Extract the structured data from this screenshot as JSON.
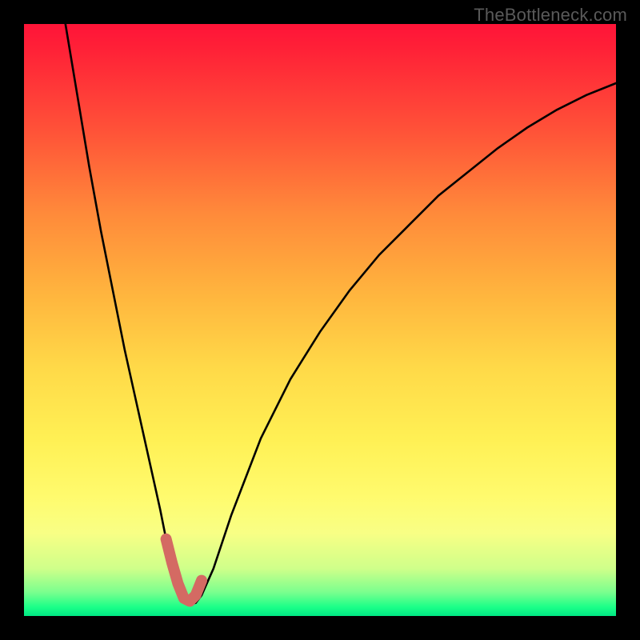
{
  "watermark": "TheBottleneck.com",
  "chart_data": {
    "type": "line",
    "title": "",
    "xlabel": "",
    "ylabel": "",
    "xlim": [
      0,
      100
    ],
    "ylim": [
      0,
      100
    ],
    "grid": false,
    "legend": false,
    "series": [
      {
        "name": "bottleneck-curve",
        "x": [
          7,
          9,
          11,
          13,
          15,
          17,
          19,
          21,
          23,
          24,
          25,
          26,
          27,
          28,
          29,
          30,
          32,
          35,
          40,
          45,
          50,
          55,
          60,
          65,
          70,
          75,
          80,
          85,
          90,
          95,
          100
        ],
        "y": [
          100,
          88,
          76,
          65,
          55,
          45,
          36,
          27,
          18,
          13,
          9,
          5.5,
          3,
          2,
          2.2,
          3.5,
          8,
          17,
          30,
          40,
          48,
          55,
          61,
          66,
          71,
          75,
          79,
          82.5,
          85.5,
          88,
          90
        ]
      }
    ],
    "annotations": [
      {
        "name": "sweet-spot-marker",
        "x": [
          24,
          25,
          26,
          27,
          28,
          29,
          30
        ],
        "y": [
          13,
          9,
          5.5,
          3,
          2.5,
          3.5,
          6
        ],
        "color": "#d46a63"
      }
    ]
  }
}
